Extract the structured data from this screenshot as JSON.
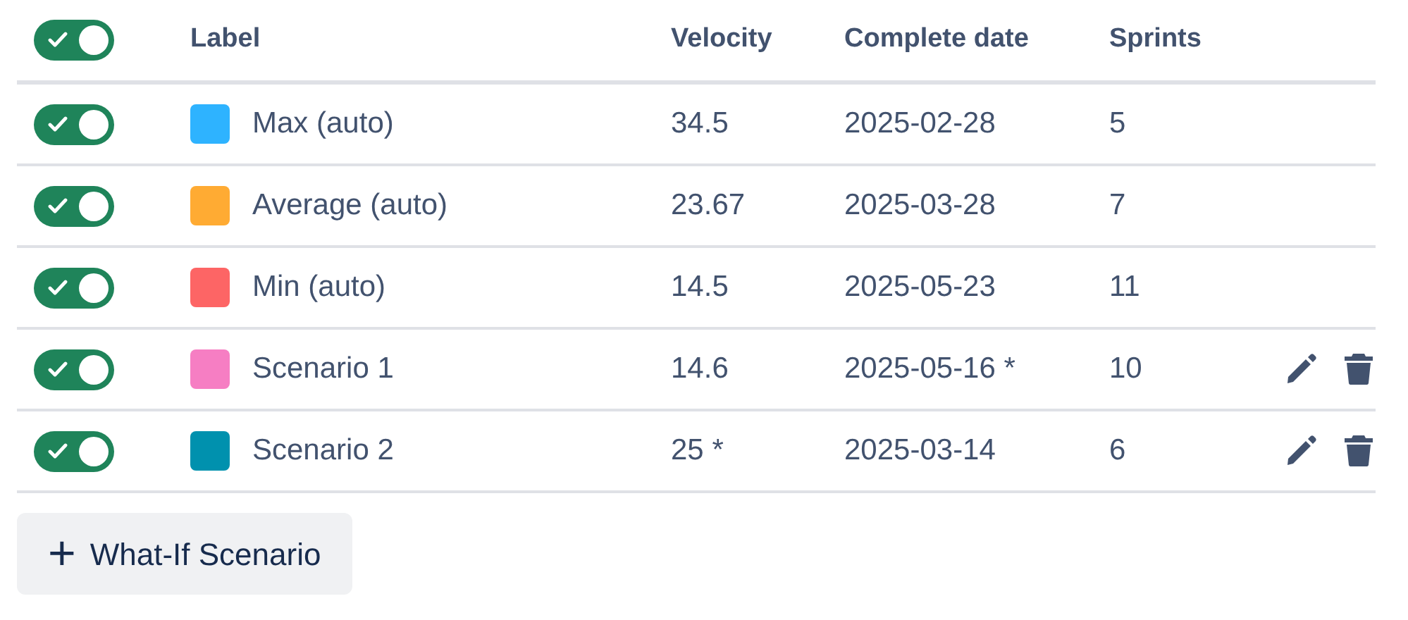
{
  "table": {
    "all_on": true,
    "columns": [
      "Label",
      "Velocity",
      "Complete date",
      "Sprints"
    ],
    "rows": [
      {
        "on": true,
        "color": "#2eb3ff",
        "label": "Max (auto)",
        "velocity": "34.5",
        "complete_date": "2025-02-28",
        "sprints": "5",
        "editable": false
      },
      {
        "on": true,
        "color": "#ffab33",
        "label": "Average (auto)",
        "velocity": "23.67",
        "complete_date": "2025-03-28",
        "sprints": "7",
        "editable": false
      },
      {
        "on": true,
        "color": "#fd6565",
        "label": "Min (auto)",
        "velocity": "14.5",
        "complete_date": "2025-05-23",
        "sprints": "11",
        "editable": false
      },
      {
        "on": true,
        "color": "#f67ec3",
        "label": "Scenario 1",
        "velocity": "14.6",
        "complete_date": "2025-05-16 *",
        "sprints": "10",
        "editable": true
      },
      {
        "on": true,
        "color": "#0091ae",
        "label": "Scenario 2",
        "velocity": "25 *",
        "complete_date": "2025-03-14",
        "sprints": "6",
        "editable": true
      }
    ]
  },
  "add_button": {
    "icon": "+",
    "label": "What-If Scenario"
  }
}
